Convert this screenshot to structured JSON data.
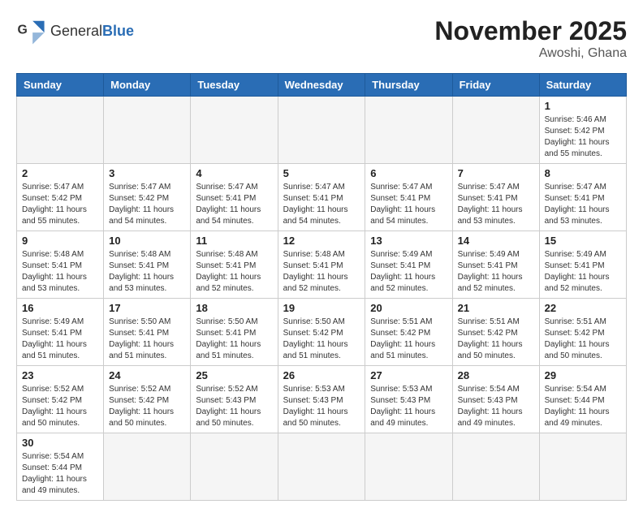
{
  "header": {
    "logo_general": "General",
    "logo_blue": "Blue",
    "month_year": "November 2025",
    "location": "Awoshi, Ghana"
  },
  "weekdays": [
    "Sunday",
    "Monday",
    "Tuesday",
    "Wednesday",
    "Thursday",
    "Friday",
    "Saturday"
  ],
  "days": {
    "d1": {
      "num": "1",
      "sunrise": "5:46 AM",
      "sunset": "5:42 PM",
      "daylight": "11 hours and 55 minutes."
    },
    "d2": {
      "num": "2",
      "sunrise": "5:47 AM",
      "sunset": "5:42 PM",
      "daylight": "11 hours and 55 minutes."
    },
    "d3": {
      "num": "3",
      "sunrise": "5:47 AM",
      "sunset": "5:42 PM",
      "daylight": "11 hours and 54 minutes."
    },
    "d4": {
      "num": "4",
      "sunrise": "5:47 AM",
      "sunset": "5:41 PM",
      "daylight": "11 hours and 54 minutes."
    },
    "d5": {
      "num": "5",
      "sunrise": "5:47 AM",
      "sunset": "5:41 PM",
      "daylight": "11 hours and 54 minutes."
    },
    "d6": {
      "num": "6",
      "sunrise": "5:47 AM",
      "sunset": "5:41 PM",
      "daylight": "11 hours and 54 minutes."
    },
    "d7": {
      "num": "7",
      "sunrise": "5:47 AM",
      "sunset": "5:41 PM",
      "daylight": "11 hours and 53 minutes."
    },
    "d8": {
      "num": "8",
      "sunrise": "5:47 AM",
      "sunset": "5:41 PM",
      "daylight": "11 hours and 53 minutes."
    },
    "d9": {
      "num": "9",
      "sunrise": "5:48 AM",
      "sunset": "5:41 PM",
      "daylight": "11 hours and 53 minutes."
    },
    "d10": {
      "num": "10",
      "sunrise": "5:48 AM",
      "sunset": "5:41 PM",
      "daylight": "11 hours and 53 minutes."
    },
    "d11": {
      "num": "11",
      "sunrise": "5:48 AM",
      "sunset": "5:41 PM",
      "daylight": "11 hours and 52 minutes."
    },
    "d12": {
      "num": "12",
      "sunrise": "5:48 AM",
      "sunset": "5:41 PM",
      "daylight": "11 hours and 52 minutes."
    },
    "d13": {
      "num": "13",
      "sunrise": "5:49 AM",
      "sunset": "5:41 PM",
      "daylight": "11 hours and 52 minutes."
    },
    "d14": {
      "num": "14",
      "sunrise": "5:49 AM",
      "sunset": "5:41 PM",
      "daylight": "11 hours and 52 minutes."
    },
    "d15": {
      "num": "15",
      "sunrise": "5:49 AM",
      "sunset": "5:41 PM",
      "daylight": "11 hours and 52 minutes."
    },
    "d16": {
      "num": "16",
      "sunrise": "5:49 AM",
      "sunset": "5:41 PM",
      "daylight": "11 hours and 51 minutes."
    },
    "d17": {
      "num": "17",
      "sunrise": "5:50 AM",
      "sunset": "5:41 PM",
      "daylight": "11 hours and 51 minutes."
    },
    "d18": {
      "num": "18",
      "sunrise": "5:50 AM",
      "sunset": "5:41 PM",
      "daylight": "11 hours and 51 minutes."
    },
    "d19": {
      "num": "19",
      "sunrise": "5:50 AM",
      "sunset": "5:42 PM",
      "daylight": "11 hours and 51 minutes."
    },
    "d20": {
      "num": "20",
      "sunrise": "5:51 AM",
      "sunset": "5:42 PM",
      "daylight": "11 hours and 51 minutes."
    },
    "d21": {
      "num": "21",
      "sunrise": "5:51 AM",
      "sunset": "5:42 PM",
      "daylight": "11 hours and 50 minutes."
    },
    "d22": {
      "num": "22",
      "sunrise": "5:51 AM",
      "sunset": "5:42 PM",
      "daylight": "11 hours and 50 minutes."
    },
    "d23": {
      "num": "23",
      "sunrise": "5:52 AM",
      "sunset": "5:42 PM",
      "daylight": "11 hours and 50 minutes."
    },
    "d24": {
      "num": "24",
      "sunrise": "5:52 AM",
      "sunset": "5:42 PM",
      "daylight": "11 hours and 50 minutes."
    },
    "d25": {
      "num": "25",
      "sunrise": "5:52 AM",
      "sunset": "5:43 PM",
      "daylight": "11 hours and 50 minutes."
    },
    "d26": {
      "num": "26",
      "sunrise": "5:53 AM",
      "sunset": "5:43 PM",
      "daylight": "11 hours and 50 minutes."
    },
    "d27": {
      "num": "27",
      "sunrise": "5:53 AM",
      "sunset": "5:43 PM",
      "daylight": "11 hours and 49 minutes."
    },
    "d28": {
      "num": "28",
      "sunrise": "5:54 AM",
      "sunset": "5:43 PM",
      "daylight": "11 hours and 49 minutes."
    },
    "d29": {
      "num": "29",
      "sunrise": "5:54 AM",
      "sunset": "5:44 PM",
      "daylight": "11 hours and 49 minutes."
    },
    "d30": {
      "num": "30",
      "sunrise": "5:54 AM",
      "sunset": "5:44 PM",
      "daylight": "11 hours and 49 minutes."
    }
  }
}
